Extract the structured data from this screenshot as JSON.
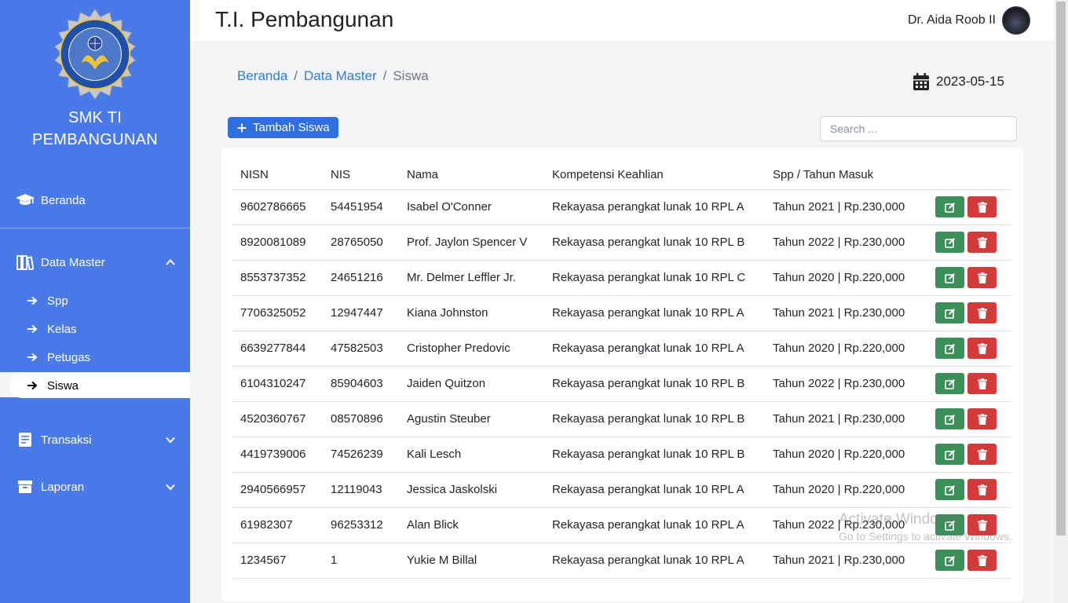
{
  "sidebar": {
    "school_name_line1": "SMK TI",
    "school_name_line2": "PEMBANGUNAN",
    "items": {
      "beranda": "Beranda",
      "data_master": "Data Master",
      "transaksi": "Transaksi",
      "laporan": "Laporan"
    },
    "sub_items": [
      "Spp",
      "Kelas",
      "Petugas",
      "Siswa"
    ],
    "active": "Siswa",
    "logo_text": "SMK TEKNOLOGI INDUSTRI PEMBANGUNAN KOTA CIMAHI"
  },
  "header": {
    "title": "T.I. Pembangunan",
    "user_name": "Dr. Aida Roob II"
  },
  "breadcrumb": {
    "items": [
      "Beranda",
      "Data Master"
    ],
    "current": "Siswa",
    "separator": "/"
  },
  "date": "2023-05-15",
  "toolbar": {
    "add_label": "Tambah Siswa",
    "search_placeholder": "Search ..."
  },
  "table": {
    "columns": [
      "NISN",
      "NIS",
      "Nama",
      "Kompetensi Keahlian",
      "Spp / Tahun Masuk"
    ],
    "rows": [
      [
        "9602786665",
        "54451954",
        "Isabel O'Conner",
        "Rekayasa perangkat lunak 10 RPL A",
        "Tahun 2021 | Rp.230,000"
      ],
      [
        "8920081089",
        "28765050",
        "Prof. Jaylon Spencer V",
        "Rekayasa perangkat lunak 10 RPL B",
        "Tahun 2022 | Rp.230,000"
      ],
      [
        "8553737352",
        "24651216",
        "Mr. Delmer Leffler Jr.",
        "Rekayasa perangkat lunak 10 RPL C",
        "Tahun 2020 | Rp.220,000"
      ],
      [
        "7706325052",
        "12947447",
        "Kiana Johnston",
        "Rekayasa perangkat lunak 10 RPL A",
        "Tahun 2021 | Rp.230,000"
      ],
      [
        "6639277844",
        "47582503",
        "Cristopher Predovic",
        "Rekayasa perangkat lunak 10 RPL A",
        "Tahun 2020 | Rp.220,000"
      ],
      [
        "6104310247",
        "85904603",
        "Jaiden Quitzon",
        "Rekayasa perangkat lunak 10 RPL B",
        "Tahun 2022 | Rp.230,000"
      ],
      [
        "4520360767",
        "08570896",
        "Agustin Steuber",
        "Rekayasa perangkat lunak 10 RPL B",
        "Tahun 2021 | Rp.230,000"
      ],
      [
        "4419739006",
        "74526239",
        "Kali Lesch",
        "Rekayasa perangkat lunak 10 RPL B",
        "Tahun 2020 | Rp.220,000"
      ],
      [
        "2940566957",
        "12119043",
        "Jessica Jaskolski",
        "Rekayasa perangkat lunak 10 RPL A",
        "Tahun 2020 | Rp.220,000"
      ],
      [
        "61982307",
        "96253312",
        "Alan Blick",
        "Rekayasa perangkat lunak 10 RPL A",
        "Tahun 2022 | Rp.230,000"
      ],
      [
        "1234567",
        "1",
        "Yukie M Billal",
        "Rekayasa perangkat lunak 10 RPL A",
        "Tahun 2021 | Rp.230,000"
      ]
    ]
  },
  "watermark": {
    "line1": "Activate Windows",
    "line2": "Go to Settings to activate Windows."
  },
  "colors": {
    "sidebar": "#4a7ae8",
    "primary": "#2f6fe0",
    "edit": "#3d8f5a",
    "delete": "#d33a3a",
    "link": "#2f7ae0"
  },
  "icons": [
    "graduation-cap-icon",
    "books-icon",
    "chevron-up-icon",
    "chevron-down-icon",
    "arrow-right-icon",
    "receipt-icon",
    "archive-icon",
    "calendar-icon",
    "plus-icon",
    "edit-icon",
    "trash-icon"
  ]
}
